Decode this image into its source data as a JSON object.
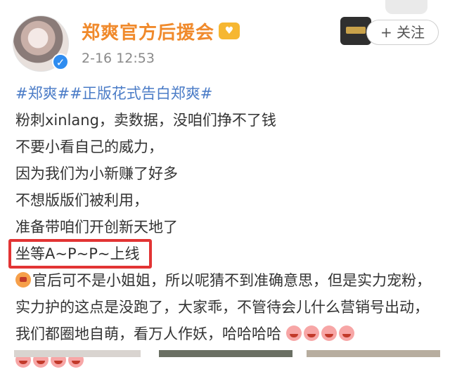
{
  "post": {
    "username": "郑爽官方后援会",
    "timestamp": "2-16 12:53",
    "follow_label": "+ 关注",
    "hashtags": "#郑爽##正版花式告白郑爽#",
    "lines": [
      "粉刺xinlang，卖数据，没咱们挣不了钱",
      "不要小看自己的威力，",
      "因为我们为小新赚了好多",
      "不想版版们被利用，",
      "准备带咱们开创新天地了"
    ],
    "highlighted_line": "坐等A~P~P~上线",
    "paragraph": "官后可不是小姐姐，所以呢猜不到准确意思，但是实力宠粉，实力护的这点是没跑了，大家乖，不管待会儿什么营销号出动，我们都圈地自萌，看万人作妖，哈哈哈哈"
  },
  "icons": {
    "verify": "verified-check-icon",
    "fan_badge": "fan-badge-icon",
    "group": "group-icon",
    "emoji_mouth": "mouth-emoji-icon",
    "emoji_laugh": "laugh-emoji-icon"
  },
  "colors": {
    "username": "#f08a2c",
    "hashtag": "#4b7cc7",
    "highlight_box": "#e23434",
    "verify": "#2e8cf0"
  }
}
